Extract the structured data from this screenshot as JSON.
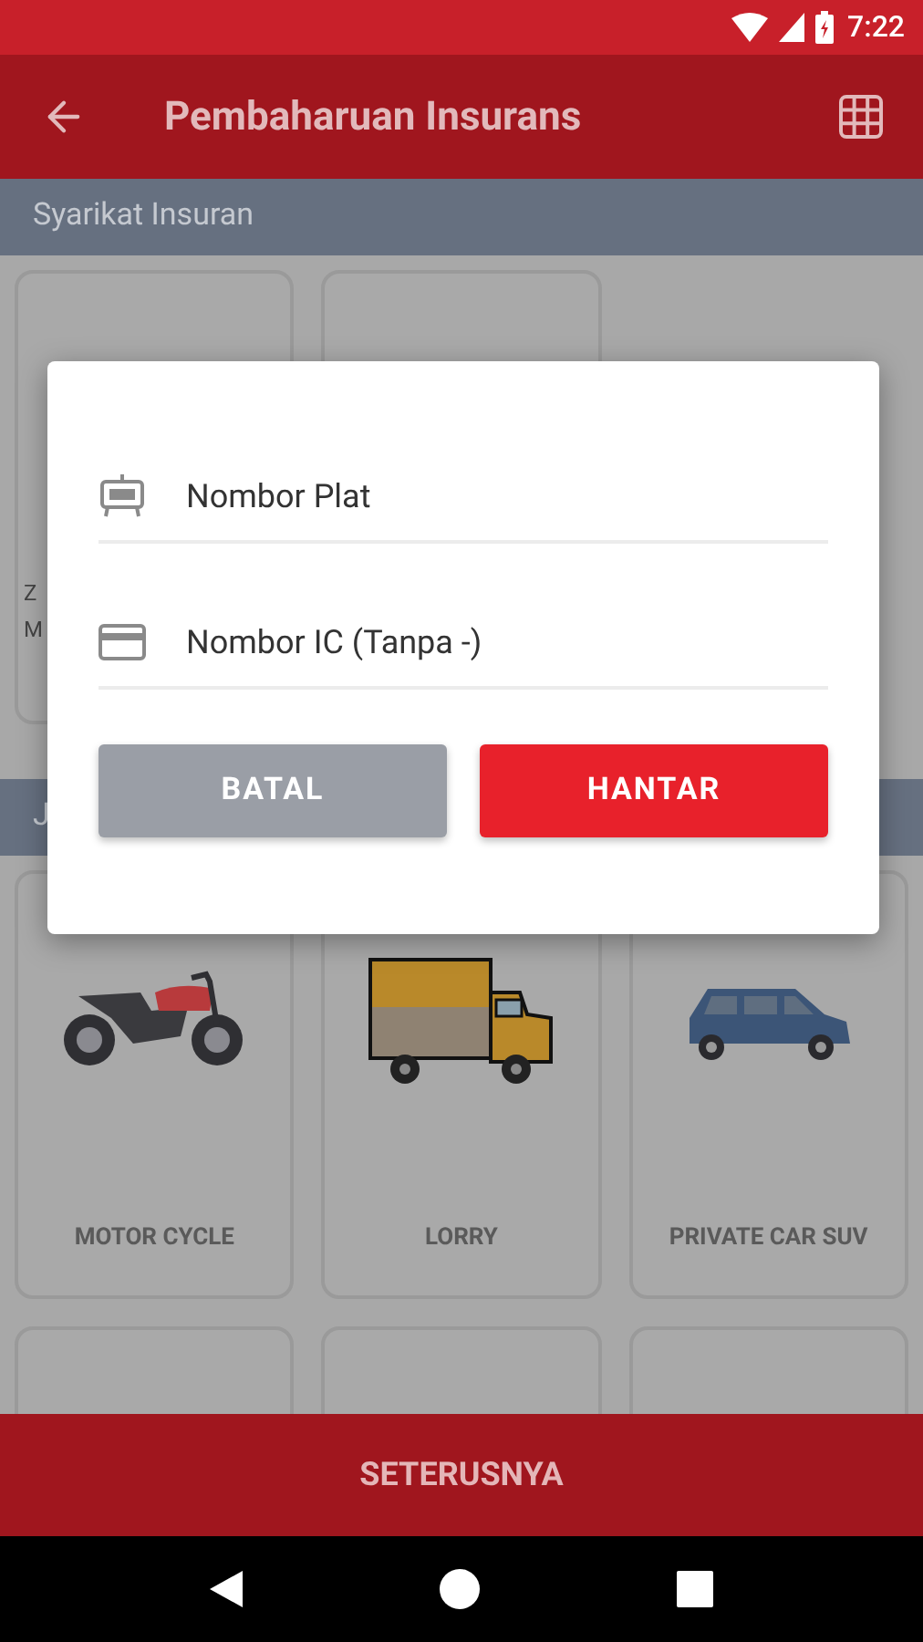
{
  "status_bar": {
    "time": "7:22"
  },
  "app_bar": {
    "title": "Pembaharuan Insurans"
  },
  "sections": [
    {
      "title": "Syarikat Insuran",
      "cards": [
        {
          "kind": "text",
          "lines": [
            "Z",
            "M"
          ]
        },
        {
          "kind": "blank"
        }
      ]
    },
    {
      "title": "J",
      "cards": [
        {
          "kind": "motorcycle",
          "label": "MOTOR CYCLE"
        },
        {
          "kind": "lorry",
          "label": "LORRY"
        },
        {
          "kind": "car",
          "label": "PRIVATE CAR SUV"
        },
        {
          "kind": "blank"
        },
        {
          "kind": "blank"
        },
        {
          "kind": "blank"
        }
      ]
    }
  ],
  "dialog": {
    "fields": [
      {
        "kind": "plate",
        "placeholder": "Nombor Plat"
      },
      {
        "kind": "ic",
        "placeholder": "Nombor IC (Tanpa -)"
      }
    ],
    "buttons": [
      {
        "kind": "cancel",
        "label": "BATAL"
      },
      {
        "kind": "submit",
        "label": "HANTAR"
      }
    ]
  },
  "bottom_button": {
    "label": "SETERUSNYA"
  }
}
